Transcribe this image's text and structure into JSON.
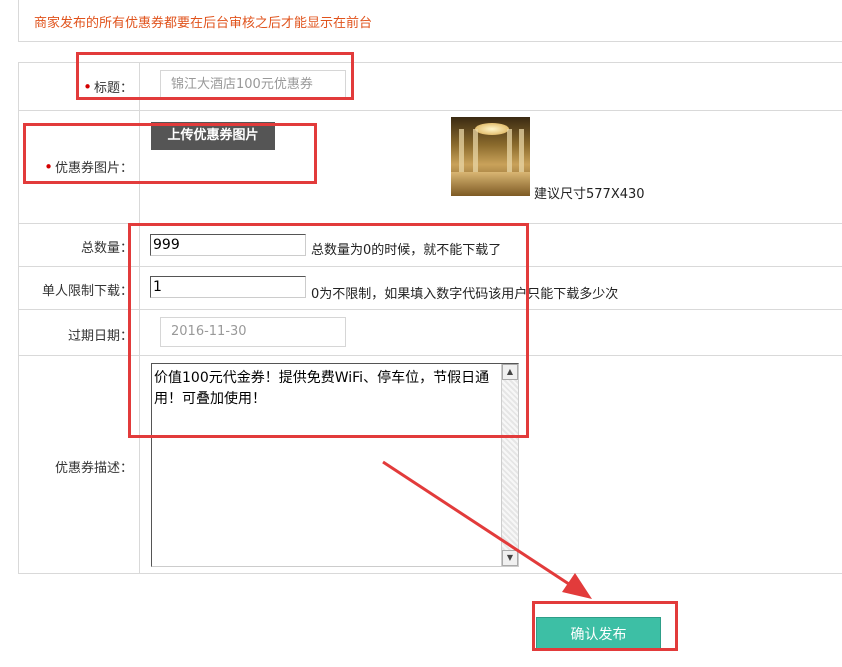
{
  "notice": "商家发布的所有优惠券都要在后台审核之后才能显示在前台",
  "form": {
    "title": {
      "label": "标题：",
      "placeholder": "锦江大酒店100元优惠券"
    },
    "image": {
      "label": "优惠券图片：",
      "upload_button": "上传优惠券图片",
      "size_hint": "建议尺寸577X430"
    },
    "total": {
      "label": "总数量：",
      "value": "999",
      "hint": "总数量为0的时候，就不能下载了"
    },
    "limit": {
      "label": "单人限制下载：",
      "value": "1",
      "hint": "0为不限制，如果填入数字代码该用户只能下载多少次"
    },
    "expire": {
      "label": "过期日期：",
      "placeholder": "2016-11-30"
    },
    "description": {
      "label": "优惠券描述：",
      "value": "价值100元代金券！提供免费WiFi、停车位，节假日通用！可叠加使用！"
    }
  },
  "submit_label": "确认发布",
  "colors": {
    "notice": "#e0531c",
    "submit_bg": "#3dbfa5",
    "annotation_red": "#e23b3b",
    "required_dot": "#d40000"
  },
  "icons": {
    "scroll_up": "scroll-up-arrow-icon",
    "scroll_down": "scroll-down-arrow-icon"
  }
}
